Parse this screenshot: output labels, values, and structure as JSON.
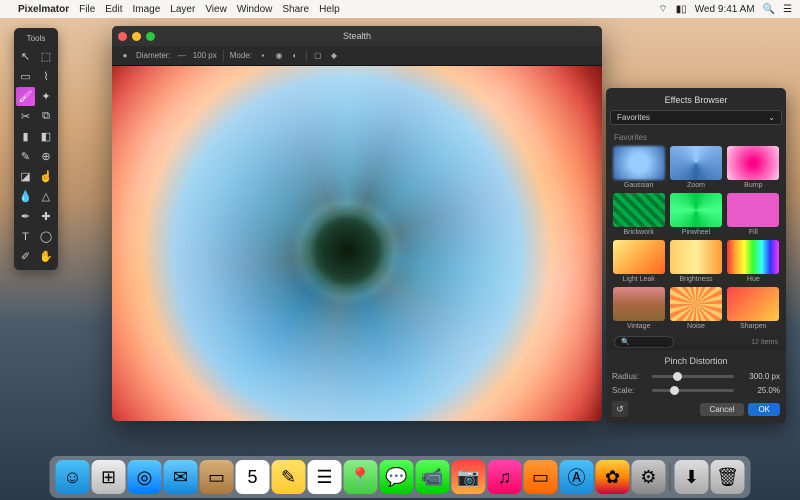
{
  "menubar": {
    "app": "Pixelmator",
    "items": [
      "File",
      "Edit",
      "Image",
      "Layer",
      "View",
      "Window",
      "Share",
      "Help"
    ],
    "clock": "Wed 9:41 AM"
  },
  "tools": {
    "title": "Tools",
    "items": [
      {
        "name": "move-tool",
        "glyph": "↖"
      },
      {
        "name": "transform-tool",
        "glyph": "⬚"
      },
      {
        "name": "marquee-tool",
        "glyph": "▭"
      },
      {
        "name": "lasso-tool",
        "glyph": "⌇"
      },
      {
        "name": "brush-tool",
        "glyph": "🖌",
        "active": true
      },
      {
        "name": "magic-wand-tool",
        "glyph": "✦"
      },
      {
        "name": "crop-tool",
        "glyph": "✂"
      },
      {
        "name": "slice-tool",
        "glyph": "⧉"
      },
      {
        "name": "paint-bucket-tool",
        "glyph": "▮"
      },
      {
        "name": "gradient-tool",
        "glyph": "◧"
      },
      {
        "name": "pencil-tool",
        "glyph": "✎"
      },
      {
        "name": "clone-tool",
        "glyph": "⊕"
      },
      {
        "name": "eraser-tool",
        "glyph": "◪"
      },
      {
        "name": "smudge-tool",
        "glyph": "☝"
      },
      {
        "name": "blur-tool",
        "glyph": "💧"
      },
      {
        "name": "sharpen-tool",
        "glyph": "△"
      },
      {
        "name": "pen-tool",
        "glyph": "✒"
      },
      {
        "name": "healing-tool",
        "glyph": "✚"
      },
      {
        "name": "type-tool",
        "glyph": "T"
      },
      {
        "name": "shape-tool",
        "glyph": "◯"
      },
      {
        "name": "eyedropper-tool",
        "glyph": "✐"
      },
      {
        "name": "hand-tool",
        "glyph": "✋"
      }
    ]
  },
  "document": {
    "title": "Stealth",
    "options": {
      "diameter_label": "Diameter:",
      "diameter_value": "100 px",
      "mode_label": "Mode:"
    }
  },
  "effects": {
    "title": "Effects Browser",
    "dropdown": "Favorites",
    "section": "Favorites",
    "items": [
      {
        "label": "Gaussian",
        "cls": "g-gaussian"
      },
      {
        "label": "Zoom",
        "cls": "g-zoom"
      },
      {
        "label": "Bump",
        "cls": "g-bump"
      },
      {
        "label": "Brickwork",
        "cls": "g-brick"
      },
      {
        "label": "Pinwheel",
        "cls": "g-pinwheel"
      },
      {
        "label": "Fill",
        "cls": "g-fill"
      },
      {
        "label": "Light Leak",
        "cls": "g-lightleak"
      },
      {
        "label": "Brightness",
        "cls": "g-brightness"
      },
      {
        "label": "Hue",
        "cls": "g-hue"
      },
      {
        "label": "Vintage",
        "cls": "g-vintage"
      },
      {
        "label": "Noise",
        "cls": "g-noise"
      },
      {
        "label": "Sharpen",
        "cls": "g-sharpen"
      }
    ],
    "search_placeholder": "",
    "count": "12 Items"
  },
  "distortion": {
    "title": "Pinch Distortion",
    "radius_label": "Radius:",
    "radius_value": "300.0 px",
    "scale_label": "Scale:",
    "scale_value": "25.0%",
    "cancel": "Cancel",
    "ok": "OK"
  },
  "dock": {
    "items": [
      {
        "name": "finder",
        "bg": "linear-gradient(#4ac0f8,#1a8ad8)",
        "glyph": "☺"
      },
      {
        "name": "launchpad",
        "bg": "linear-gradient(#eee,#bbb)",
        "glyph": "⊞"
      },
      {
        "name": "safari",
        "bg": "linear-gradient(#5ac8fa,#007aff)",
        "glyph": "◎"
      },
      {
        "name": "mail",
        "bg": "linear-gradient(#6cf,#18d)",
        "glyph": "✉"
      },
      {
        "name": "contacts",
        "bg": "linear-gradient(#d8b078,#a87840)",
        "glyph": "▭"
      },
      {
        "name": "calendar",
        "bg": "#fff",
        "glyph": "5"
      },
      {
        "name": "notes",
        "bg": "linear-gradient(#ffe066,#ffc933)",
        "glyph": "✎"
      },
      {
        "name": "reminders",
        "bg": "#fff",
        "glyph": "☰"
      },
      {
        "name": "maps",
        "bg": "linear-gradient(#8e8,#4c4)",
        "glyph": "📍"
      },
      {
        "name": "messages",
        "bg": "linear-gradient(#5f5,#0c0)",
        "glyph": "💬"
      },
      {
        "name": "facetime",
        "bg": "linear-gradient(#5f5,#0c0)",
        "glyph": "📹"
      },
      {
        "name": "photobooth",
        "bg": "linear-gradient(#f44,#fa4)",
        "glyph": "📷"
      },
      {
        "name": "itunes",
        "bg": "linear-gradient(#f4a,#f06)",
        "glyph": "♫"
      },
      {
        "name": "ibooks",
        "bg": "linear-gradient(#ff9933,#ff6600)",
        "glyph": "▭"
      },
      {
        "name": "appstore",
        "bg": "linear-gradient(#4ac0f8,#1a8ad8)",
        "glyph": "Ⓐ"
      },
      {
        "name": "pixelmator",
        "bg": "linear-gradient(#fc4,#f80,#c04)",
        "glyph": "✿"
      },
      {
        "name": "preferences",
        "bg": "linear-gradient(#ccc,#888)",
        "glyph": "⚙"
      }
    ],
    "right": [
      {
        "name": "downloads",
        "bg": "linear-gradient(#ddd,#aaa)",
        "glyph": "⬇"
      },
      {
        "name": "trash",
        "bg": "linear-gradient(#ddd,#aaa)",
        "glyph": "🗑"
      }
    ]
  }
}
